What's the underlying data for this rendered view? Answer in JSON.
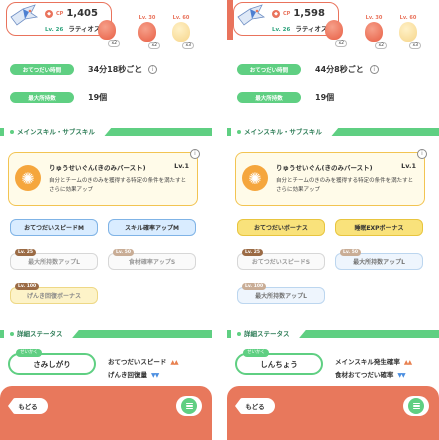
{
  "left": {
    "header": {
      "cp_label": "CP",
      "cp": "1,405",
      "level": "Lv. 26",
      "name": "ラティオス"
    },
    "berries": [
      {
        "lv_label": "Lv. 30",
        "count": "x2",
        "kind": "red"
      },
      {
        "lv_label": "Lv. 60",
        "count": "x3",
        "kind": "egg"
      }
    ],
    "first_count": "x2",
    "stats": [
      {
        "label": "おてつだい時間",
        "value": "34分18秒ごと",
        "info": "i"
      },
      {
        "label": "最大所持数",
        "value": "19個"
      }
    ],
    "section_skills": "メインスキル・サブスキル",
    "main_skill": {
      "name": "りゅうせいぐん(きのみバースト)",
      "level": "Lv.1",
      "desc": "自分とチームのきのみを獲得する特定の条件を満たすとさらに効果アップ",
      "info": "i"
    },
    "sub_skills": [
      {
        "label": "おてつだいスピードM",
        "style": "blue",
        "tag": ""
      },
      {
        "label": "スキル確率アップM",
        "style": "blue",
        "tag": ""
      },
      {
        "label": "最大所持数アップL",
        "style": "gray",
        "tag": "Lv. 25"
      },
      {
        "label": "食材確率アップS",
        "style": "gray",
        "tag": "Lv. 50"
      },
      {
        "label": "げんき回復ボーナス",
        "style": "pale-gold",
        "tag": "Lv. 100"
      }
    ],
    "section_detail": "詳細ステータス",
    "nature_tag": "せいかく",
    "nature": "さみしがり",
    "effects": [
      {
        "label": "おてつだいスピード",
        "arrows": "▲▲",
        "dir": "up"
      },
      {
        "label": "げんき回復量",
        "arrows": "▼▼",
        "dir": "down"
      }
    ],
    "back": "もどる"
  },
  "right": {
    "header": {
      "cp_label": "CP",
      "cp": "1,598",
      "level": "Lv. 26",
      "name": "ラティオス"
    },
    "berries": [
      {
        "lv_label": "Lv. 30",
        "count": "x2",
        "kind": "red"
      },
      {
        "lv_label": "Lv. 60",
        "count": "x3",
        "kind": "egg"
      }
    ],
    "first_count": "x2",
    "stats": [
      {
        "label": "おてつだい時間",
        "value": "44分8秒ごと",
        "info": "i"
      },
      {
        "label": "最大所持数",
        "value": "19個"
      }
    ],
    "section_skills": "メインスキル・サブスキル",
    "main_skill": {
      "name": "りゅうせいぐん(きのみバースト)",
      "level": "Lv.1",
      "desc": "自分とチームのきのみを獲得する特定の条件を満たすとさらに効果アップ",
      "info": "i"
    },
    "sub_skills": [
      {
        "label": "おてつだいボーナス",
        "style": "gold",
        "tag": ""
      },
      {
        "label": "睡眠EXPボーナス",
        "style": "gold",
        "tag": ""
      },
      {
        "label": "おてつだいスピードS",
        "style": "gray",
        "tag": "Lv. 25"
      },
      {
        "label": "最大所持数アップL",
        "style": "pale-blue",
        "tag": "Lv. 50"
      },
      {
        "label": "最大所持数アップL",
        "style": "pale-blue",
        "tag": "Lv. 100"
      }
    ],
    "section_detail": "詳細ステータス",
    "nature_tag": "せいかく",
    "nature": "しんちょう",
    "effects": [
      {
        "label": "メインスキル発生確率",
        "arrows": "▲▲",
        "dir": "up"
      },
      {
        "label": "食材おてつだい確率",
        "arrows": "▼▼",
        "dir": "down"
      }
    ],
    "back": "もどる"
  },
  "colors": {
    "accent": "#e8785c",
    "green": "#5fcf82",
    "gold": "#f2c452",
    "blue": "#7fb3e6"
  }
}
